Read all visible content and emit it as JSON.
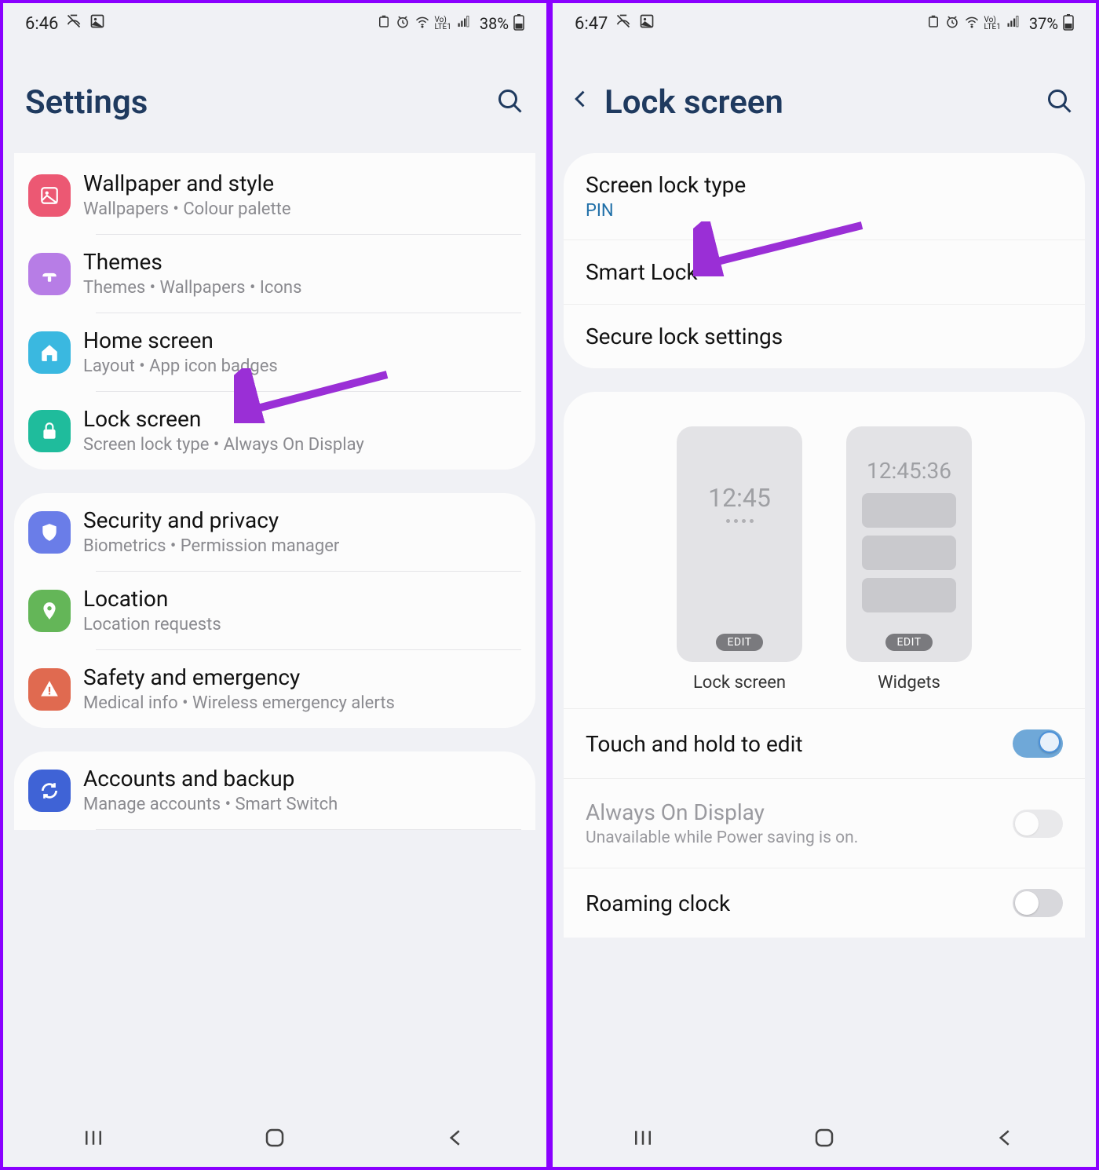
{
  "left": {
    "status": {
      "time": "6:46",
      "battery": "38%"
    },
    "title": "Settings",
    "groups": [
      {
        "items": [
          {
            "iconColor": "#ec5873",
            "iconGlyph": "image",
            "title": "Wallpaper and style",
            "sub": "Wallpapers  •  Colour palette"
          },
          {
            "iconColor": "#b77de6",
            "iconGlyph": "brush",
            "title": "Themes",
            "sub": "Themes  •  Wallpapers  •  Icons"
          },
          {
            "iconColor": "#3ab8e0",
            "iconGlyph": "home",
            "title": "Home screen",
            "sub": "Layout  •  App icon badges"
          },
          {
            "iconColor": "#1fbc9c",
            "iconGlyph": "lock",
            "title": "Lock screen",
            "sub": "Screen lock type  •  Always On Display"
          }
        ]
      },
      {
        "items": [
          {
            "iconColor": "#6a7de8",
            "iconGlyph": "shield",
            "title": "Security and privacy",
            "sub": "Biometrics  •  Permission manager"
          },
          {
            "iconColor": "#64b658",
            "iconGlyph": "pin",
            "title": "Location",
            "sub": "Location requests"
          },
          {
            "iconColor": "#e06a50",
            "iconGlyph": "alert",
            "title": "Safety and emergency",
            "sub": "Medical info  •  Wireless emergency alerts"
          }
        ]
      },
      {
        "items": [
          {
            "iconColor": "#3f63d6",
            "iconGlyph": "sync",
            "title": "Accounts and backup",
            "sub": "Manage accounts  •  Smart Switch"
          }
        ]
      }
    ]
  },
  "right": {
    "status": {
      "time": "6:47",
      "battery": "37%"
    },
    "title": "Lock screen",
    "section1": [
      {
        "title": "Screen lock type",
        "sub": "PIN",
        "subAccent": true
      },
      {
        "title": "Smart Lock"
      },
      {
        "title": "Secure lock settings"
      }
    ],
    "previews": {
      "lock": {
        "time": "12:45",
        "edit": "EDIT",
        "label": "Lock screen"
      },
      "widgets": {
        "time": "12:45:36",
        "edit": "EDIT",
        "label": "Widgets"
      }
    },
    "switches": [
      {
        "title": "Touch and hold to edit",
        "on": true
      },
      {
        "title": "Always On Display",
        "sub": "Unavailable while Power saving is on.",
        "on": false,
        "disabled": true
      },
      {
        "title": "Roaming clock",
        "on": false
      }
    ]
  }
}
